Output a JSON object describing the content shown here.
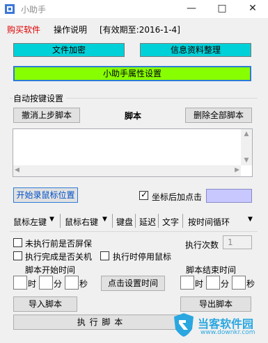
{
  "window": {
    "title": "小助手"
  },
  "menu": {
    "buy": "购买软件",
    "help": "操作说明",
    "valid": "[有效期至:2016-1-4]"
  },
  "colors": {
    "buy_red": "#e00000",
    "cyan": "#00d0d8",
    "green": "#88ff00",
    "color_swatch": "#c8c8ff"
  },
  "buttons": {
    "file_encrypt": "文件加密",
    "info_organize": "信息资料整理",
    "properties": "小助手属性设置",
    "undo_script": "撤消上步脚本",
    "delete_all": "删除全部脚本",
    "start_record": "开始录鼠标位置",
    "click_set_time": "点击设置时间",
    "import_script": "导入脚本",
    "export_script": "导出脚本",
    "run_script": "执 行 脚 本"
  },
  "section": {
    "auto_keys": "自动按键设置",
    "script": "脚本"
  },
  "coords_click": {
    "label": "坐标后加点击",
    "checked": true
  },
  "toolbar": {
    "mouse_left": "鼠标左键",
    "mouse_right": "鼠标右键",
    "keyboard": "键盘",
    "delay": "延迟",
    "text": "文字",
    "loop_mode": "按时间循环"
  },
  "options": {
    "screen_save": {
      "label": "未执行前是否屏保",
      "checked": false
    },
    "shutdown": {
      "label": "执行完成是否关机",
      "checked": false
    },
    "disable_mouse": {
      "label": "执行时停用鼠标",
      "checked": false
    },
    "run_count_label": "执行次数",
    "run_count_value": "1"
  },
  "time": {
    "start_label": "脚本开始时间",
    "end_label": "脚本结束时间",
    "hour": "时",
    "minute": "分",
    "second": "秒"
  },
  "watermark": {
    "brand": "当客软件园",
    "url": "www.downkr.com"
  }
}
